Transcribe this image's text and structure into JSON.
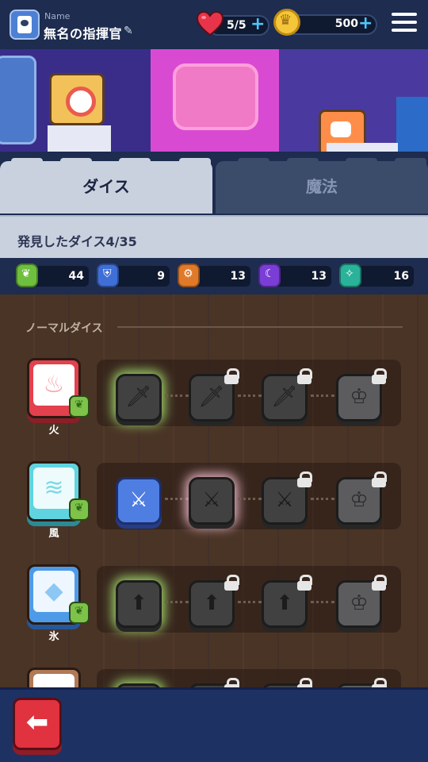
{
  "header": {
    "name_label": "Name",
    "player_name": "無名の指揮官",
    "hearts": "5/5",
    "gold": "500"
  },
  "tabs": [
    {
      "label": "ダイス",
      "active": true
    },
    {
      "label": "魔法",
      "active": false
    }
  ],
  "found_label": "発見したダイス4/35",
  "resources": [
    {
      "icon": "leaf-icon",
      "color": "#6fbf3f",
      "value": "44"
    },
    {
      "icon": "shield-icon",
      "color": "#3f6fd6",
      "value": "9"
    },
    {
      "icon": "gear-icon",
      "color": "#e07a2a",
      "value": "13"
    },
    {
      "icon": "moon-icon",
      "color": "#7a3ed6",
      "value": "13"
    },
    {
      "icon": "compass-icon",
      "color": "#2ab39a",
      "value": "16"
    }
  ],
  "section_title": "ノーマルダイス",
  "dice": [
    {
      "name": "火",
      "color": "#e2414d",
      "skills": [
        "sword",
        "sword",
        "sword",
        "crown"
      ],
      "locked": [
        false,
        true,
        true,
        true
      ],
      "highlight": "green",
      "unlocked_blue": false
    },
    {
      "name": "風",
      "color": "#5fd4e0",
      "skills": [
        "wind-sword",
        "wind-sword",
        "wind-sword",
        "crown"
      ],
      "locked": [
        false,
        false,
        true,
        true
      ],
      "highlight": "pink",
      "unlocked_blue": true
    },
    {
      "name": "氷",
      "color": "#4d9be8",
      "skills": [
        "arrow-up",
        "arrow-up",
        "arrow-up",
        "crown"
      ],
      "locked": [
        false,
        true,
        true,
        true
      ],
      "highlight": "green",
      "unlocked_blue": false
    }
  ],
  "colors": {
    "topbar": "#1d2c4f",
    "tab_active": "#c9d1df",
    "tab_inactive": "#3b4c6b",
    "back_button": "#e0323f"
  }
}
